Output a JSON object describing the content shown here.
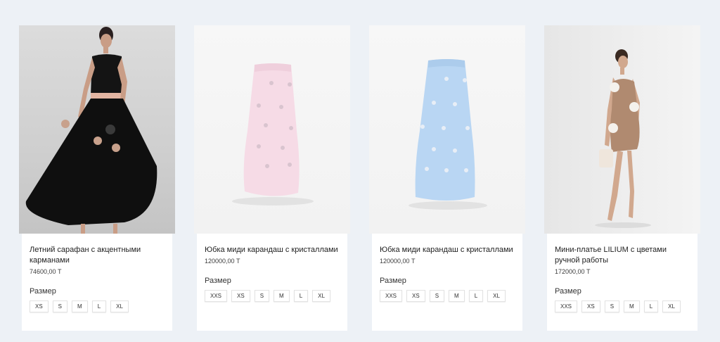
{
  "products": [
    {
      "title": "Летний сарафан с акцентными карманами",
      "price": "74600,00 Т",
      "size_label": "Размер",
      "sizes": [
        "XS",
        "S",
        "M",
        "L",
        "XL"
      ]
    },
    {
      "title": "Юбка миди карандаш с кристаллами",
      "price": "120000,00 Т",
      "size_label": "Размер",
      "sizes": [
        "XXS",
        "XS",
        "S",
        "M",
        "L",
        "XL"
      ]
    },
    {
      "title": "Юбка миди карандаш с кристаллами",
      "price": "120000,00 Т",
      "size_label": "Размер",
      "sizes": [
        "XXS",
        "XS",
        "S",
        "M",
        "L",
        "XL"
      ]
    },
    {
      "title": "Мини-платье LILIUM с цветами ручной работы",
      "price": "172000,00 Т",
      "size_label": "Размер",
      "sizes": [
        "XXS",
        "XS",
        "S",
        "M",
        "L",
        "XL"
      ]
    }
  ],
  "colors": {
    "background": "#edf1f6",
    "card": "#ffffff",
    "skirt_pink": "#f6dbe6",
    "skirt_blue": "#b9d6f3"
  }
}
